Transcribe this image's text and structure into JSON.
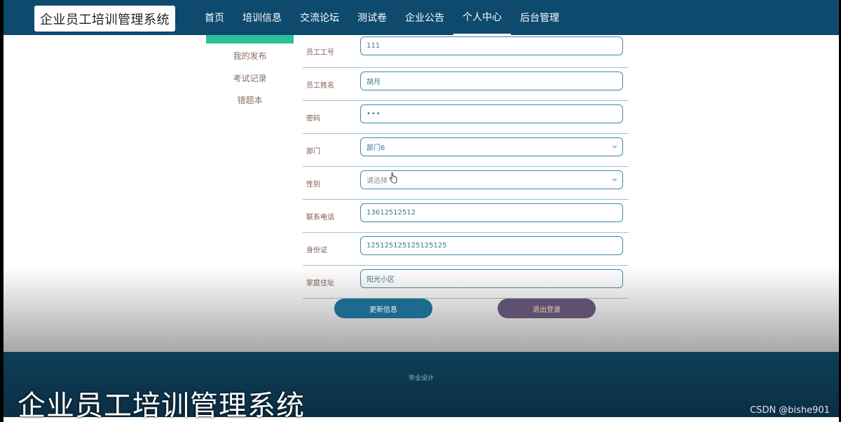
{
  "app": {
    "logo_text": "企业员工培训管理系统"
  },
  "nav": {
    "items": [
      {
        "label": "首页",
        "active": false
      },
      {
        "label": "培训信息",
        "active": false
      },
      {
        "label": "交流论坛",
        "active": false
      },
      {
        "label": "测试卷",
        "active": false
      },
      {
        "label": "企业公告",
        "active": false
      },
      {
        "label": "个人中心",
        "active": true
      },
      {
        "label": "后台管理",
        "active": false
      }
    ]
  },
  "sidebar": {
    "items": [
      {
        "label": "我的发布"
      },
      {
        "label": "考试记录"
      },
      {
        "label": "错题本"
      }
    ]
  },
  "form": {
    "fields": [
      {
        "label": "员工工号",
        "value": "111"
      },
      {
        "label": "员工姓名",
        "value": "胡月"
      },
      {
        "label": "密码",
        "value": "•••"
      },
      {
        "label": "部门",
        "value": "部门6"
      },
      {
        "label": "性别",
        "placeholder": "请选择"
      },
      {
        "label": "联系电话",
        "value": "13612512512"
      },
      {
        "label": "身份证",
        "value": "125125125125125125"
      },
      {
        "label": "家庭住址",
        "value": "阳光小区"
      }
    ]
  },
  "buttons": {
    "update": "更新信息",
    "logout": "退出登录"
  },
  "footer": {
    "text": "毕业设计"
  },
  "overlay": {
    "caption": "企业员工培训管理系统",
    "watermark": "CSDN @bishe901"
  },
  "colors": {
    "nav_bg": "#0d4a6e",
    "side_active": "#2bbf9a",
    "update_button": "#1d6a8e",
    "logout_button": "#5f5070"
  }
}
